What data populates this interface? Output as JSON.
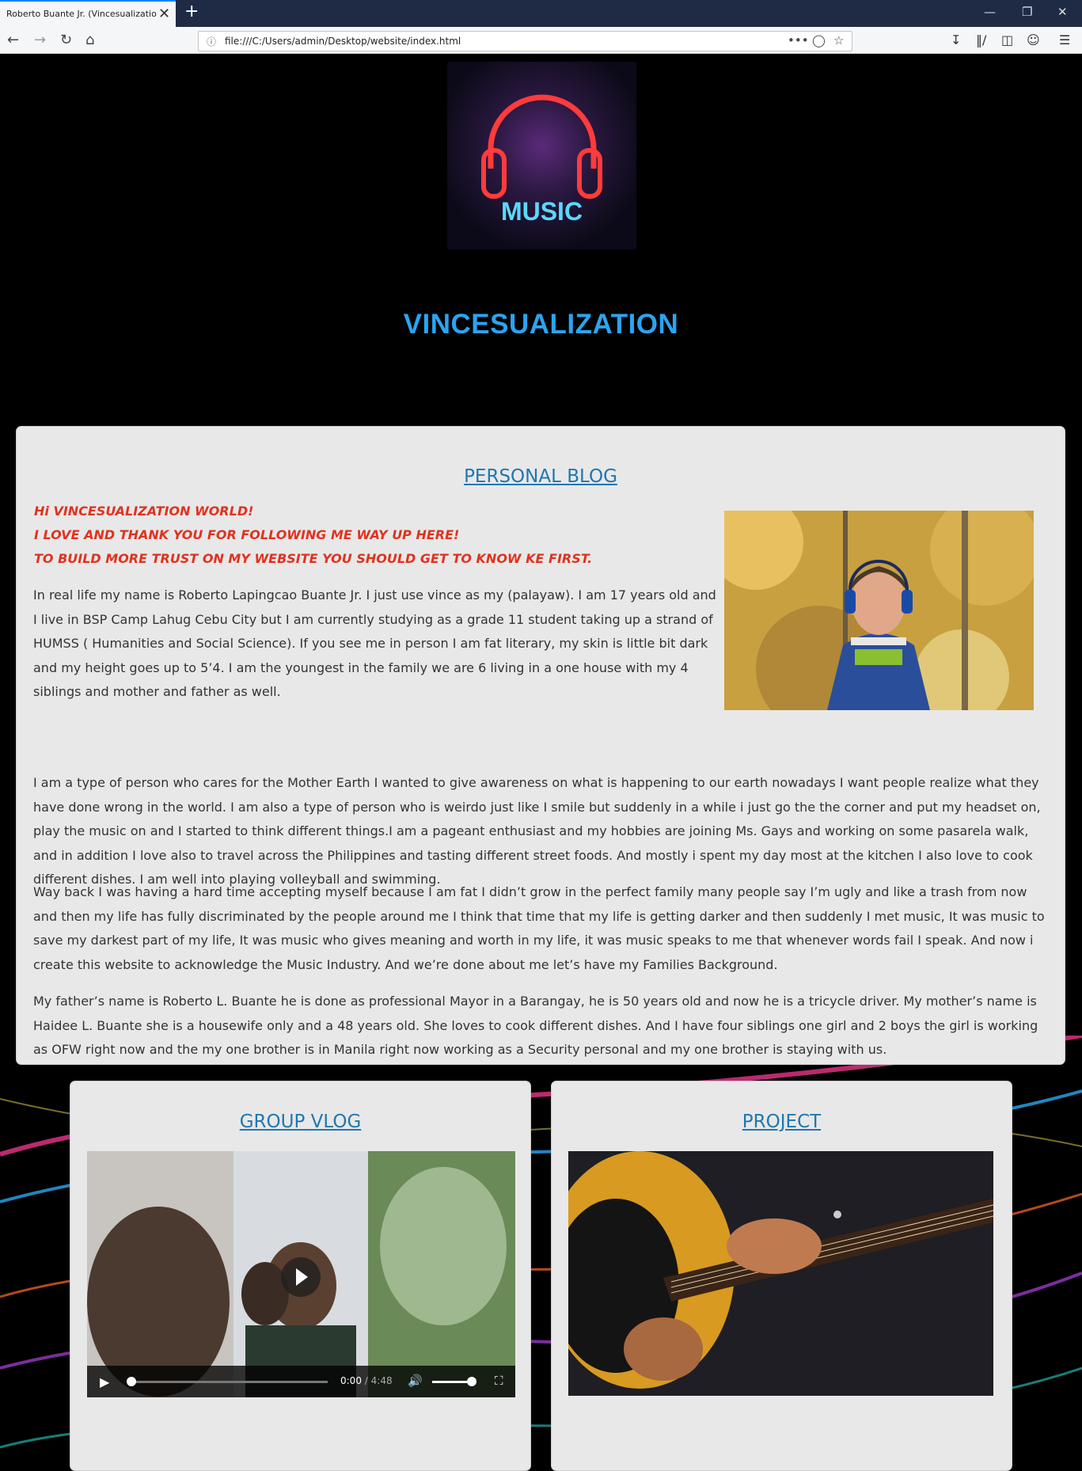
{
  "browser": {
    "tab_title": "Roberto Buante Jr. (Vincesualization)",
    "tab_close": "✕",
    "new_tab": "+",
    "url": "file:///C:/Users/admin/Desktop/website/index.html",
    "page_actions": "•••"
  },
  "header": {
    "logo_text": "MUSIC",
    "site_title": "VINCESUALIZATION"
  },
  "blog": {
    "heading": "PERSONAL BLOG",
    "greeting": [
      "Hi VINCESUALIZATION WORLD!",
      "I LOVE AND THANK YOU FOR FOLLOWING ME WAY UP HERE!",
      "TO BUILD MORE TRUST ON MY WEBSITE YOU SHOULD GET TO KNOW KE FIRST."
    ],
    "paragraphs": [
      "In real life my name is Roberto Lapingcao Buante Jr. I just use vince as my (palayaw). I am 17 years old and I live in BSP Camp Lahug Cebu City but I am currently studying as a grade 11 student taking up a strand of HUMSS ( Humanities and Social Science). If you see me in person I am fat literary, my skin is little bit dark and my height goes up to 5’4. I am the youngest in the family we are 6 living in a one house with my 4 siblings and mother and father as well.",
      "I am a type of person who cares for the Mother Earth I wanted to give awareness on what is happening to our earth nowadays I want people realize what they have done wrong in the world. I am also a type of person who is weirdo just like I smile but suddenly in a while i just go the the corner and put my headset on, play the music on and I started to think different things.I am a pageant enthusiast and my hobbies are joining Ms. Gays and working on some pasarela walk, and in addition I love also to travel across the Philippines and tasting different street foods. And mostly i spent my day most at the kitchen I also love to cook different dishes. I am well into playing volleyball and swimming.",
      "Way back I was having a hard time accepting myself because I am fat I didn’t grow in the perfect family many people say I’m ugly and like a trash from now and then my life has fully discriminated by the people around me I think that time that my life is getting darker and then suddenly I met music, It was music to save my darkest part of my life, It was music who gives meaning and worth in my life, it was music speaks to me that whenever words fail I speak. And now i create this website to acknowledge the Music Industry. And we’re done about me let’s have my Families Background.",
      "My father’s name is Roberto L. Buante he is done as professional Mayor in a Barangay, he is 50 years old and now he is a tricycle driver. My mother’s name is Haidee L. Buante she is a housewife only and a 48 years old. She loves to cook different dishes. And I have four siblings one girl and 2 boys the girl is working as OFW right now and the my one brother is in Manila right now working as a Security personal and my one brother is staying with us."
    ]
  },
  "vlog": {
    "heading": "GROUP VLOG",
    "current_time": "0:00",
    "duration": "/ 4:48",
    "progress": 0,
    "volume": 0.9
  },
  "project": {
    "heading": "PROJECT"
  },
  "colors": {
    "title_blue": "#2ba4f2",
    "heading_blue": "#1f77b0",
    "greeting_red": "#e0321e",
    "card_bg": "#e8e8e8"
  }
}
